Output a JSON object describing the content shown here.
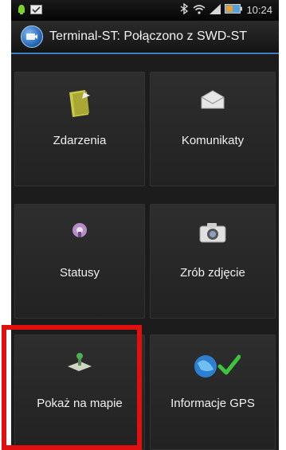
{
  "status_bar": {
    "time": "10:24",
    "icons": [
      "notification-icon",
      "message-icon",
      "wifi-icon",
      "signal-icon",
      "battery-icon"
    ]
  },
  "app": {
    "title": "Terminal-ST: Połączono z SWD-ST",
    "icon": "app-logo-icon"
  },
  "tiles": [
    {
      "label": "Zdarzenia",
      "icon": "folder-note-icon"
    },
    {
      "label": "Komunikaty",
      "icon": "envelope-icon"
    },
    {
      "label": "Statusy",
      "icon": "status-dot-icon"
    },
    {
      "label": "Zrób zdjęcie",
      "icon": "camera-icon"
    },
    {
      "label": "Pokaż na mapie",
      "icon": "map-pin-icon"
    },
    {
      "label": "Informacje GPS",
      "icon": "globe-check-icon"
    }
  ],
  "highlight": {
    "target": "Pokaż na mapie",
    "color": "#e01010"
  },
  "colors": {
    "accent": "#3f7fbf",
    "tile_bg": "#2a2a2a",
    "check_green": "#3cc43c"
  }
}
